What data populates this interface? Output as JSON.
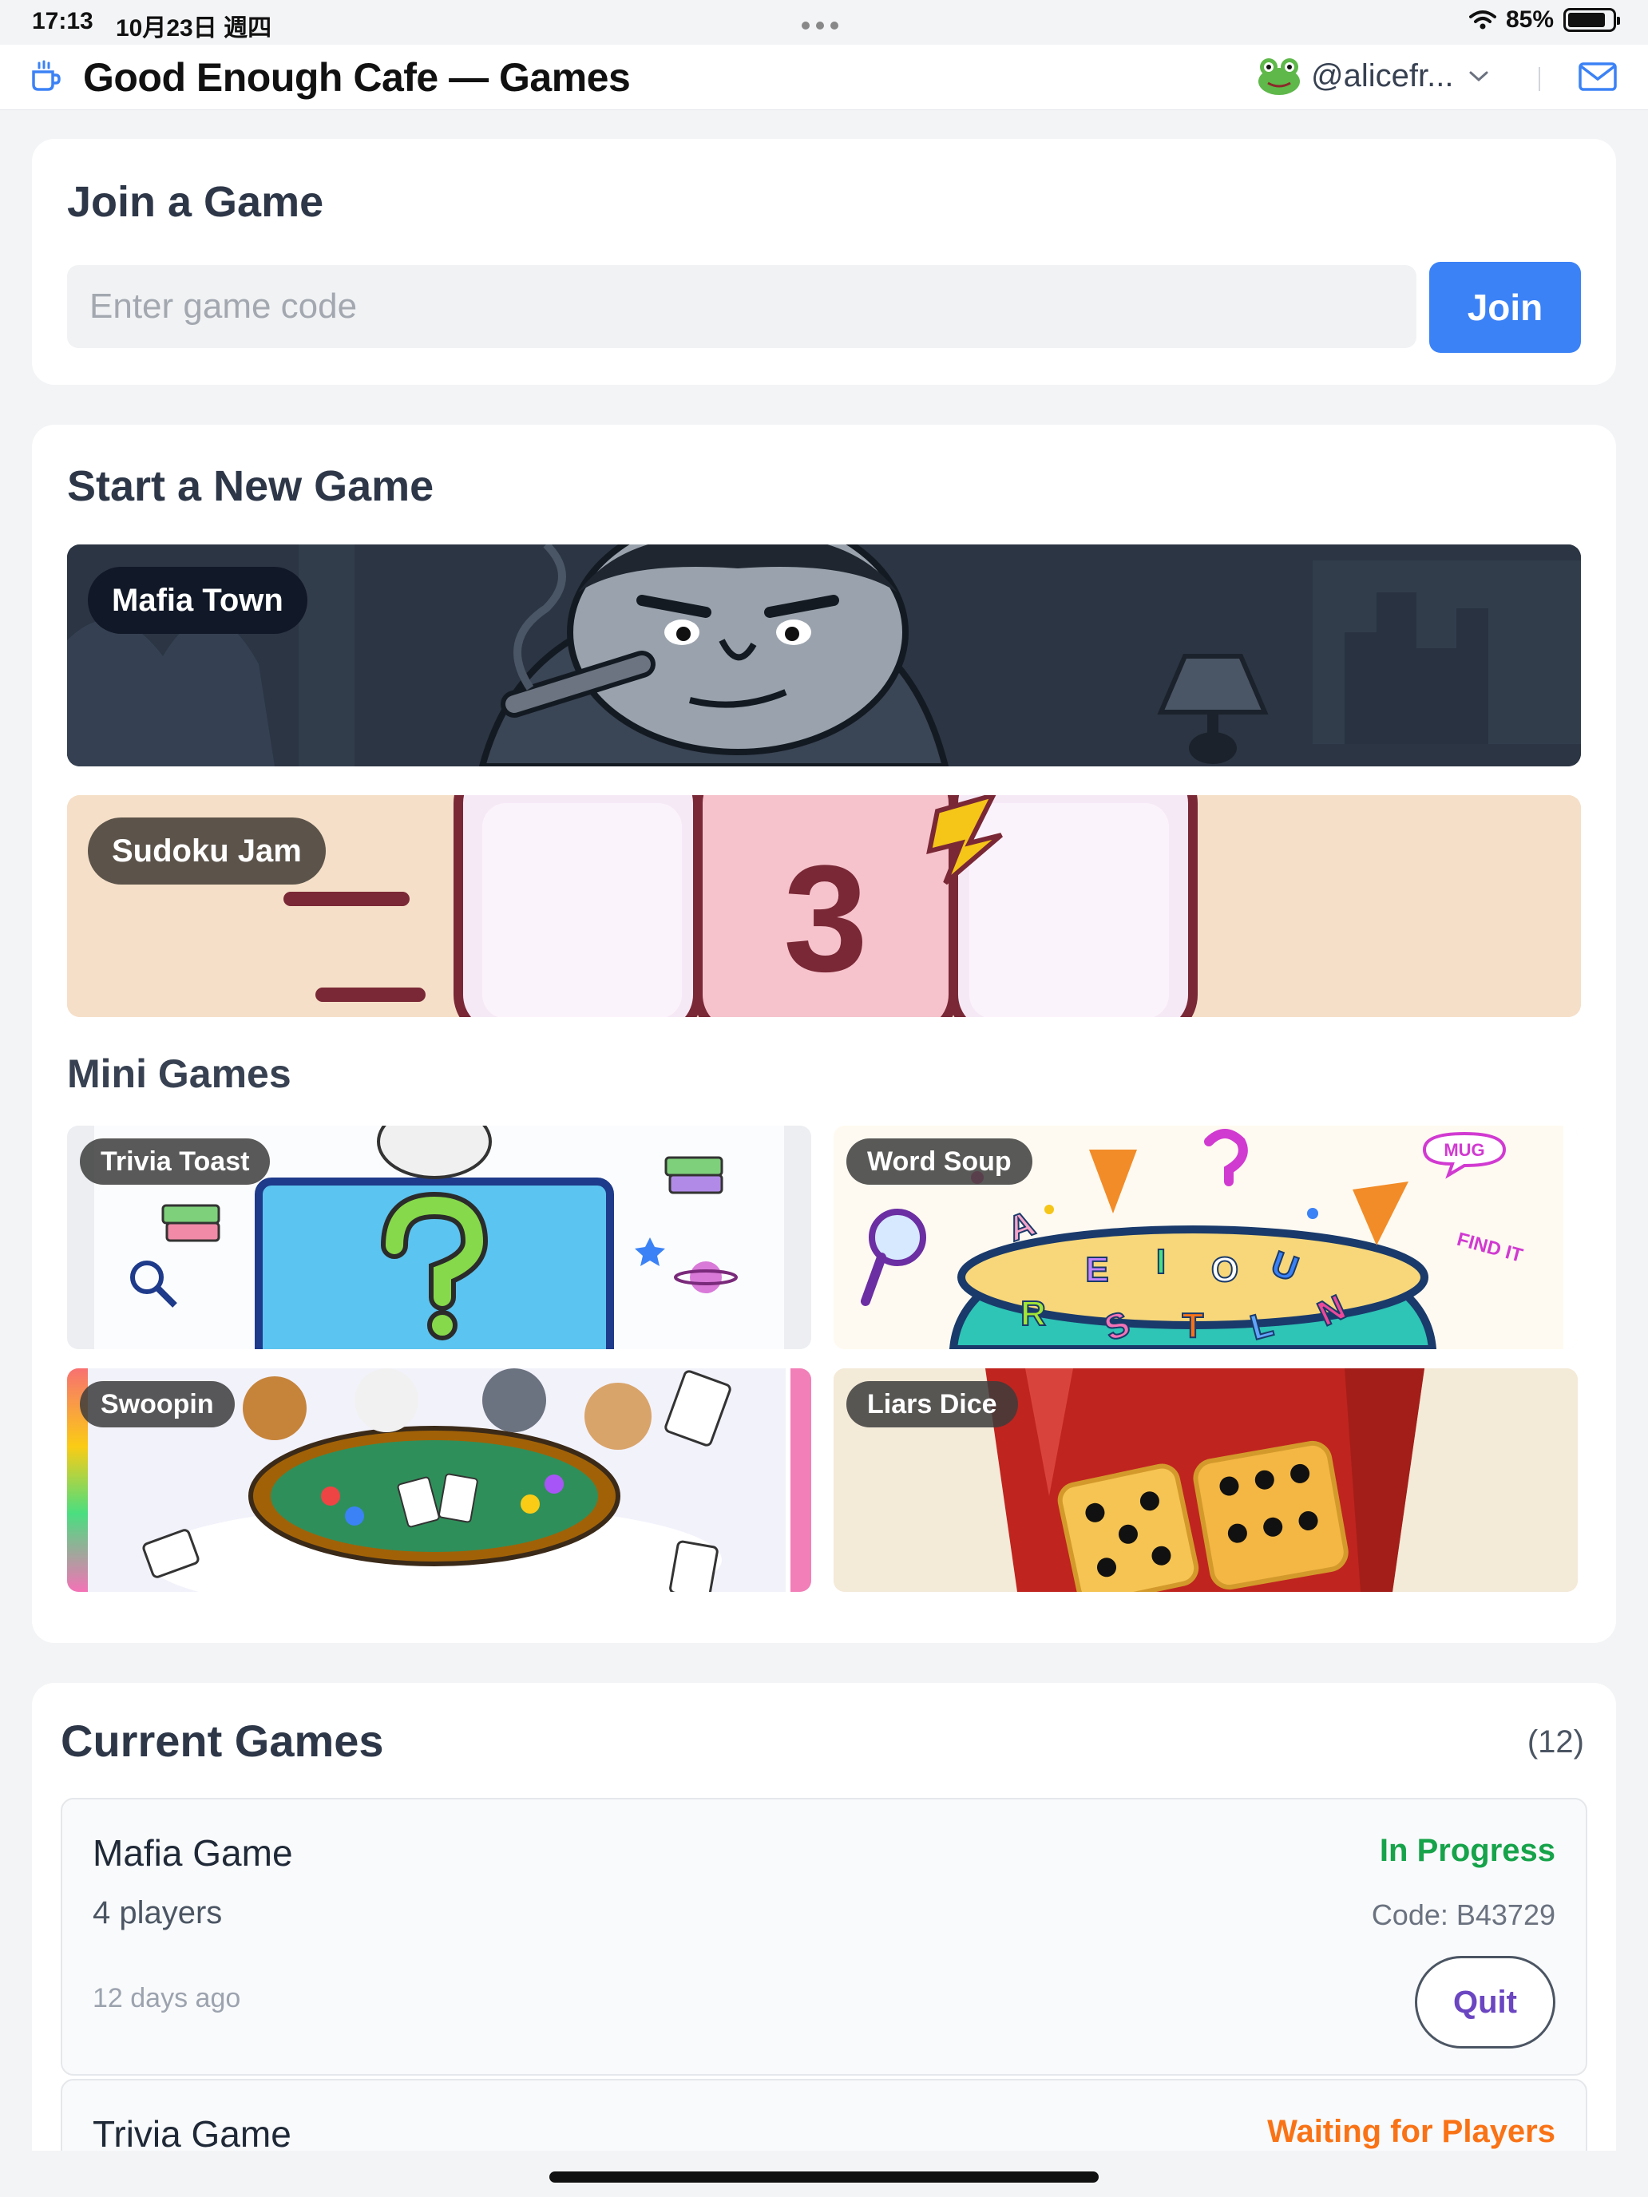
{
  "status_bar": {
    "time": "17:13",
    "date": "10月23日 週四",
    "battery": "85%"
  },
  "app": {
    "title": "Good Enough Cafe — Games",
    "username": "@alicefr..."
  },
  "join": {
    "title": "Join a Game",
    "placeholder": "Enter game code",
    "button": "Join"
  },
  "start": {
    "title": "Start a New Game",
    "featured": [
      {
        "label": "Mafia Town"
      },
      {
        "label": "Sudoku Jam",
        "tile_digit": "3"
      }
    ],
    "mini_title": "Mini Games",
    "mini": [
      {
        "label": "Trivia Toast"
      },
      {
        "label": "Word Soup",
        "tile_letters": [
          "A",
          "E",
          "I",
          "O",
          "U",
          "R",
          "S",
          "T",
          "L",
          "N"
        ],
        "sticker_mug": "MUG",
        "sticker_find": "FIND IT"
      },
      {
        "label": "Swoopin"
      },
      {
        "label": "Liars Dice"
      }
    ]
  },
  "current": {
    "title": "Current Games",
    "count": "(12)",
    "games": [
      {
        "name": "Mafia Game",
        "status": "In Progress",
        "players": "4 players",
        "code": "Code: B43729",
        "time": "12 days ago",
        "action": "Quit"
      },
      {
        "name": "Trivia Game",
        "status": "Waiting for Players"
      }
    ]
  },
  "colors": {
    "accent": "#3b82f6",
    "in_progress": "#16a34a",
    "waiting": "#f97316",
    "quit_text": "#6b46c1"
  }
}
